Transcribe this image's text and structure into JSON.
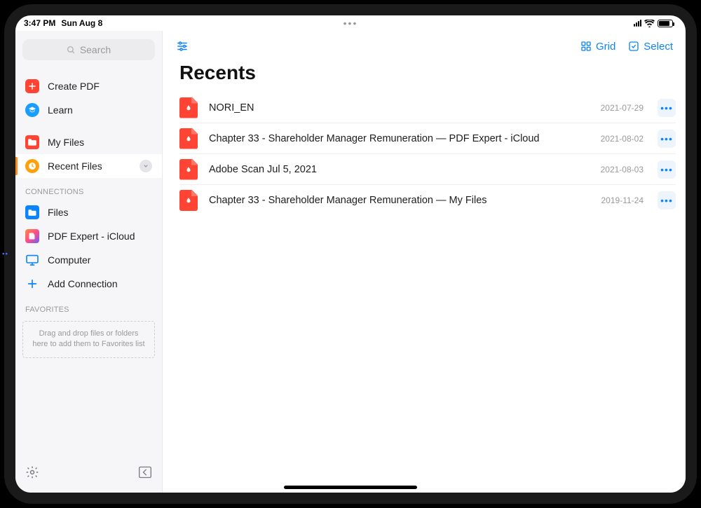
{
  "status": {
    "time": "3:47 PM",
    "date": "Sun Aug 8"
  },
  "search": {
    "placeholder": "Search"
  },
  "sidebar": {
    "top": [
      {
        "label": "Create PDF"
      },
      {
        "label": "Learn"
      }
    ],
    "library": [
      {
        "label": "My Files"
      },
      {
        "label": "Recent Files",
        "active": true
      }
    ],
    "connections_header": "CONNECTIONS",
    "connections": [
      {
        "label": "Files"
      },
      {
        "label": "PDF Expert - iCloud"
      },
      {
        "label": "Computer"
      },
      {
        "label": "Add Connection"
      }
    ],
    "favorites_header": "FAVORITES",
    "favorites_hint": "Drag and drop files or folders here to add them to Favorites list"
  },
  "toolbar": {
    "grid_label": "Grid",
    "select_label": "Select"
  },
  "page": {
    "title": "Recents"
  },
  "files": [
    {
      "name": "NORI_EN",
      "date": "2021-07-29"
    },
    {
      "name": "Chapter 33 - Shareholder Manager Remuneration — PDF Expert - iCloud",
      "date": "2021-08-02"
    },
    {
      "name": "Adobe Scan Jul 5, 2021",
      "date": "2021-08-03"
    },
    {
      "name": "Chapter 33 - Shareholder Manager Remuneration — My Files",
      "date": "2019-11-24"
    }
  ]
}
